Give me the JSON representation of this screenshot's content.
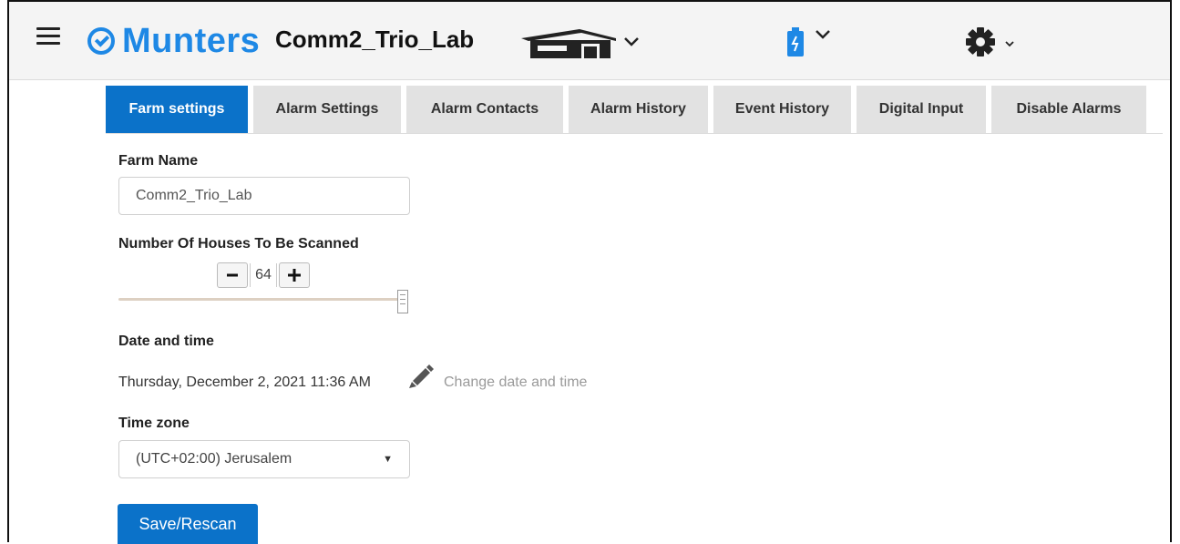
{
  "header": {
    "logo_text": "Munters",
    "farm_title": "Comm2_Trio_Lab",
    "brand_color": "#1e88e5",
    "icons": [
      "hamburger-menu-icon",
      "house-icon",
      "battery-icon",
      "gear-icon"
    ]
  },
  "tabs": [
    {
      "label": "Farm settings",
      "active": true
    },
    {
      "label": "Alarm Settings",
      "active": false
    },
    {
      "label": "Alarm Contacts",
      "active": false
    },
    {
      "label": "Alarm History",
      "active": false
    },
    {
      "label": "Event History",
      "active": false
    },
    {
      "label": "Digital Input",
      "active": false
    },
    {
      "label": "Disable Alarms",
      "active": false
    }
  ],
  "form": {
    "farm_name_label": "Farm Name",
    "farm_name_value": "Comm2_Trio_Lab",
    "houses_label": "Number Of Houses To Be Scanned",
    "houses_value": "64",
    "houses_slider_fraction": 1.0,
    "date_label": "Date and time",
    "date_value": "Thursday, December 2, 2021 11:36 AM",
    "change_link": "Change date and time",
    "timezone_label": "Time zone",
    "timezone_value": "(UTC+02:00) Jerusalem",
    "save_button": "Save/Rescan"
  },
  "colors": {
    "accent": "#0b72c9",
    "tab_inactive": "#e2e2e2"
  }
}
